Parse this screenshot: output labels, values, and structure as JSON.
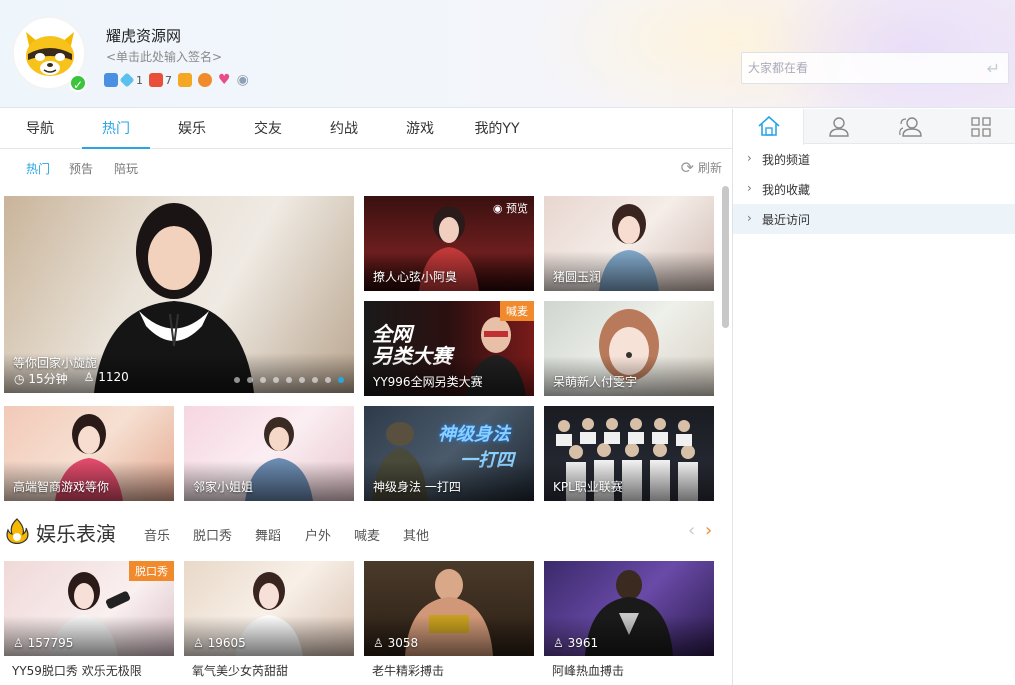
{
  "header": {
    "username": "耀虎资源网",
    "signature": "<单击此处输入签名>",
    "badge_counts": [
      "1",
      "7"
    ],
    "search_placeholder": "大家都在看"
  },
  "nav": {
    "tabs": [
      "导航",
      "热门",
      "娱乐",
      "交友",
      "约战",
      "游戏",
      "我的YY"
    ],
    "active_tab": "热门"
  },
  "subnav": {
    "items": [
      "热门",
      "预告",
      "陪玩"
    ],
    "refresh_label": "刷新"
  },
  "featured": {
    "title": "等你回家小旋旎",
    "duration": "15分钟",
    "viewers": "1120",
    "carousel_count": 9,
    "carousel_active": 9
  },
  "hot_cards": [
    {
      "title": "撩人心弦小阿臭",
      "badge": "预览"
    },
    {
      "title": "猪圆玉润",
      "badge": ""
    },
    {
      "title": "YY996全网另类大赛",
      "badge": "喊麦"
    },
    {
      "title": "呆萌新人付雯宇",
      "badge": ""
    },
    {
      "title": "高端智商游戏等你",
      "badge": ""
    },
    {
      "title": "邻家小姐姐",
      "badge": ""
    },
    {
      "title": "神级身法 一打四",
      "badge": ""
    },
    {
      "title": "KPL职业联赛",
      "badge": ""
    }
  ],
  "section": {
    "title": "娱乐表演",
    "categories": [
      "音乐",
      "脱口秀",
      "舞蹈",
      "户外",
      "喊麦",
      "其他"
    ]
  },
  "video_cards": [
    {
      "title": "YY59脱口秀 欢乐无极限",
      "viewers": "157795",
      "badge": "脱口秀"
    },
    {
      "title": "氧气美少女芮甜甜",
      "viewers": "19605",
      "badge": ""
    },
    {
      "title": "老牛精彩搏击",
      "viewers": "3058",
      "badge": ""
    },
    {
      "title": "阿峰热血搏击",
      "viewers": "3961",
      "badge": ""
    }
  ],
  "right_panel": {
    "tabs": [
      "home-icon",
      "contact-icon",
      "group-icon",
      "apps-icon"
    ],
    "items": [
      "我的频道",
      "我的收藏",
      "最近访问"
    ]
  }
}
